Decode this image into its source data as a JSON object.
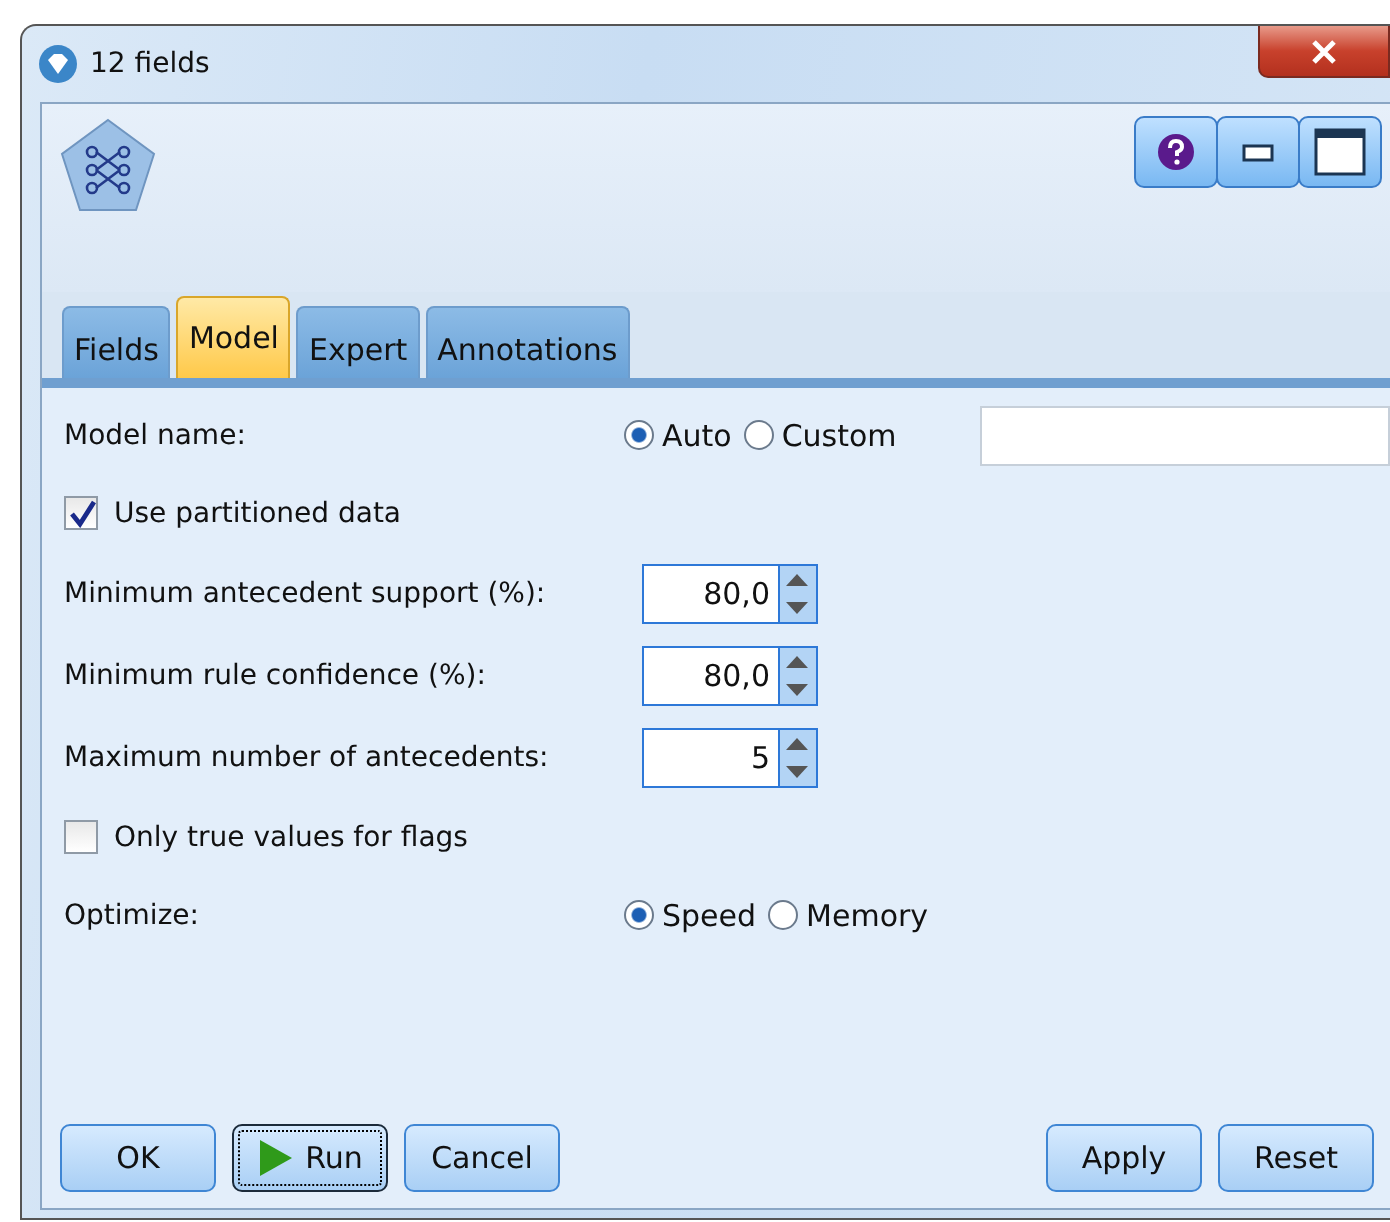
{
  "window": {
    "title": "12 fields"
  },
  "tabs": [
    {
      "label": "Fields",
      "selected": false
    },
    {
      "label": "Model",
      "selected": true
    },
    {
      "label": "Expert",
      "selected": false
    },
    {
      "label": "Annotations",
      "selected": false
    }
  ],
  "model_name": {
    "label": "Model name:",
    "options": [
      {
        "label": "Auto",
        "selected": true
      },
      {
        "label": "Custom",
        "selected": false
      }
    ]
  },
  "use_partitioned": {
    "label": "Use partitioned data",
    "checked": true
  },
  "spinners": [
    {
      "label": "Minimum antecedent support (%):",
      "value": "80,0"
    },
    {
      "label": "Minimum rule confidence (%):",
      "value": "80,0"
    },
    {
      "label": "Maximum number of antecedents:",
      "value": "5"
    }
  ],
  "only_true": {
    "label": "Only true values for flags",
    "checked": false
  },
  "optimize": {
    "label": "Optimize:",
    "options": [
      {
        "label": "Speed",
        "selected": true
      },
      {
        "label": "Memory",
        "selected": false
      }
    ]
  },
  "buttons_left": [
    {
      "label": "OK",
      "kind": "plain"
    },
    {
      "label": "Run",
      "kind": "run"
    },
    {
      "label": "Cancel",
      "kind": "plain"
    }
  ],
  "buttons_right": [
    {
      "label": "Apply"
    },
    {
      "label": "Reset"
    }
  ]
}
